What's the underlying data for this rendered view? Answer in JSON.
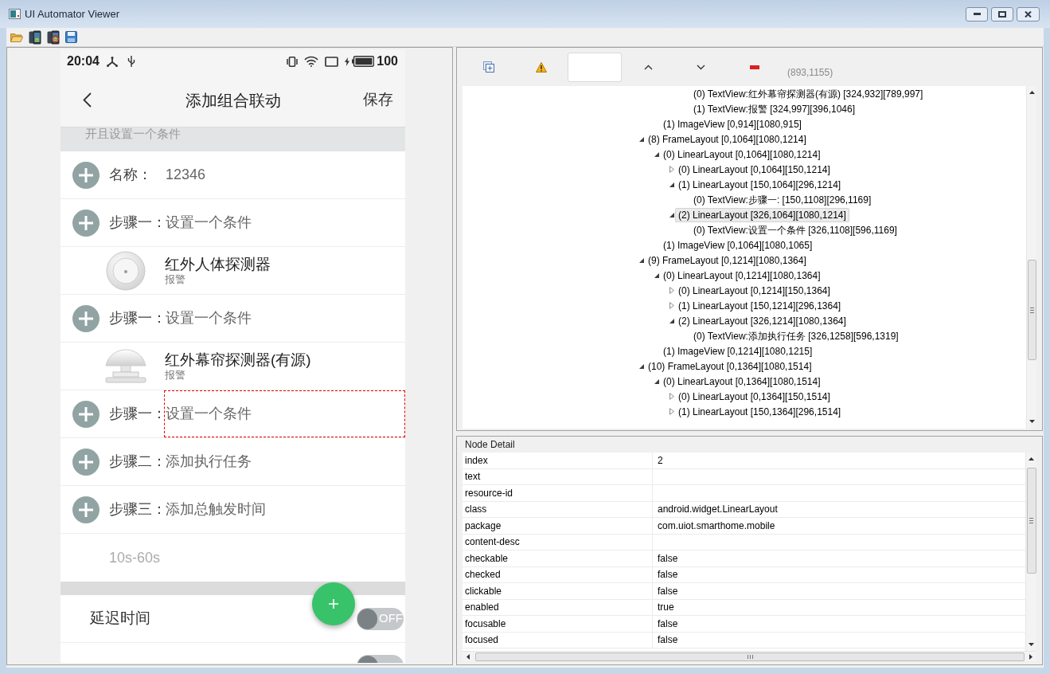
{
  "window": {
    "title": "UI Automator Viewer"
  },
  "phone": {
    "status_bar": {
      "time": "20:04",
      "battery": "100"
    },
    "app_bar": {
      "title": "添加组合联动",
      "action": "保存"
    },
    "section_hint": "开且设置一个条件",
    "rows": [
      {
        "kind": "step",
        "label": "名称：",
        "value": "12346",
        "highlighted": false
      },
      {
        "kind": "step",
        "label": "步骤一：",
        "value": "设置一个条件",
        "highlighted": false
      },
      {
        "kind": "device",
        "picture": {
          "kind": "round"
        },
        "name": "红外人体探测器",
        "detail": "报警"
      },
      {
        "kind": "step",
        "label": "步骤一：",
        "value": "设置一个条件",
        "highlighted": false
      },
      {
        "kind": "device",
        "picture": {
          "kind": "dome"
        },
        "name": "红外幕帘探测器(有源)",
        "detail": "报警"
      },
      {
        "kind": "step",
        "label": "步骤一：",
        "value": "设置一个条件",
        "highlighted": true
      },
      {
        "kind": "step",
        "label": "步骤二：",
        "value": "添加执行任务",
        "highlighted": false
      },
      {
        "kind": "step",
        "label": "步骤三：",
        "value": "添加总触发时间",
        "highlighted": false
      },
      {
        "kind": "note",
        "text": "10s-60s"
      },
      {
        "kind": "divider"
      },
      {
        "kind": "toggle",
        "label": "延迟时间",
        "on": false,
        "state_text": "OFF"
      },
      {
        "kind": "partial",
        "on": false
      }
    ]
  },
  "hierarchy": {
    "coordinates": "(893,1155)",
    "tree": [
      {
        "children": [
          {
            "children": [
              {
                "children": [
                  {
                    "label": "(0) TextView:红外幕帘探测器(有源) [324,932][789,997]",
                    "selected": false
                  },
                  {
                    "label": "(1) TextView:报警 [324,997][396,1046]",
                    "selected": false
                  }
                ]
              }
            ]
          },
          {
            "label": "(1) ImageView [0,914][1080,915]",
            "selected": false
          }
        ]
      },
      {
        "label": "(8) FrameLayout [0,1064][1080,1214]",
        "selected": false,
        "expanded": true,
        "children": [
          {
            "label": "(0) LinearLayout [0,1064][1080,1214]",
            "selected": false,
            "expanded": true,
            "children": [
              {
                "label": "(0) LinearLayout [0,1064][150,1214]",
                "selected": false,
                "expanded": false
              },
              {
                "label": "(1) LinearLayout [150,1064][296,1214]",
                "selected": false,
                "expanded": true,
                "children": [
                  {
                    "label": "(0) TextView:步骤一: [150,1108][296,1169]",
                    "selected": false
                  }
                ]
              },
              {
                "label": "(2) LinearLayout [326,1064][1080,1214]",
                "selected": true,
                "expanded": true,
                "children": [
                  {
                    "label": "(0) TextView:设置一个条件 [326,1108][596,1169]",
                    "selected": false
                  }
                ]
              }
            ]
          },
          {
            "label": "(1) ImageView [0,1064][1080,1065]",
            "selected": false
          }
        ]
      },
      {
        "label": "(9) FrameLayout [0,1214][1080,1364]",
        "selected": false,
        "expanded": true,
        "children": [
          {
            "label": "(0) LinearLayout [0,1214][1080,1364]",
            "selected": false,
            "expanded": true,
            "children": [
              {
                "label": "(0) LinearLayout [0,1214][150,1364]",
                "selected": false,
                "expanded": false
              },
              {
                "label": "(1) LinearLayout [150,1214][296,1364]",
                "selected": false,
                "expanded": false
              },
              {
                "label": "(2) LinearLayout [326,1214][1080,1364]",
                "selected": false,
                "expanded": true,
                "children": [
                  {
                    "label": "(0) TextView:添加执行任务 [326,1258][596,1319]",
                    "selected": false
                  }
                ]
              }
            ]
          },
          {
            "label": "(1) ImageView [0,1214][1080,1215]",
            "selected": false
          }
        ]
      },
      {
        "label": "(10) FrameLayout [0,1364][1080,1514]",
        "selected": false,
        "expanded": true,
        "children": [
          {
            "label": "(0) LinearLayout [0,1364][1080,1514]",
            "selected": false,
            "expanded": true,
            "children": [
              {
                "label": "(0) LinearLayout [0,1364][150,1514]",
                "selected": false,
                "expanded": false
              },
              {
                "label": "(1) LinearLayout [150,1364][296,1514]",
                "selected": false,
                "expanded": false
              }
            ]
          }
        ]
      }
    ]
  },
  "node_detail": {
    "title": "Node Detail",
    "properties": [
      {
        "name": "index",
        "value": "2"
      },
      {
        "name": "text"
      },
      {
        "name": "resource-id"
      },
      {
        "name": "class",
        "value": "android.widget.LinearLayout"
      },
      {
        "name": "package",
        "value": "com.uiot.smarthome.mobile"
      },
      {
        "name": "content-desc"
      },
      {
        "name": "checkable",
        "value": "false"
      },
      {
        "name": "checked",
        "value": "false"
      },
      {
        "name": "clickable",
        "value": "false"
      },
      {
        "name": "enabled",
        "value": "true"
      },
      {
        "name": "focusable",
        "value": "false"
      },
      {
        "name": "focused",
        "value": "false"
      }
    ]
  }
}
